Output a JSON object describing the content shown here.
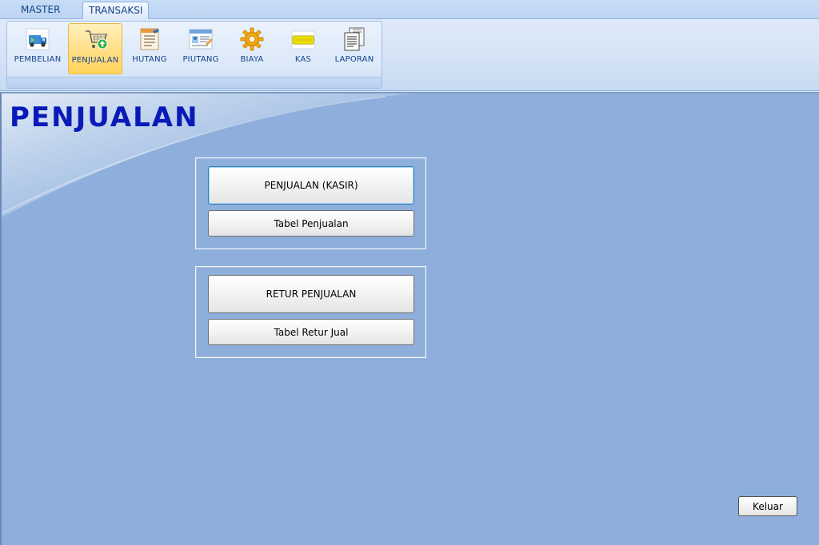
{
  "ribbon_tabs": [
    {
      "label": "MASTER",
      "active": false
    },
    {
      "label": "TRANSAKSI",
      "active": true
    }
  ],
  "ribbon_buttons": [
    {
      "label": "PEMBELIAN",
      "icon": "truck-icon"
    },
    {
      "label": "PENJUALAN",
      "icon": "shopping-cart-icon",
      "active": true
    },
    {
      "label": "HUTANG",
      "icon": "ledger-icon"
    },
    {
      "label": "PIUTANG",
      "icon": "id-card-icon"
    },
    {
      "label": "BIAYA",
      "icon": "gear-icon"
    },
    {
      "label": "KAS",
      "icon": "cash-icon"
    },
    {
      "label": "LAPORAN",
      "icon": "report-documents-icon"
    }
  ],
  "page": {
    "title": "PENJUALAN"
  },
  "panels": [
    {
      "primary_label": "PENJUALAN (KASIR)",
      "secondary_label": "Tabel Penjualan"
    },
    {
      "primary_label": "RETUR PENJUALAN",
      "secondary_label": "Tabel Retur Jual"
    }
  ],
  "footer": {
    "exit_label": "Keluar"
  },
  "colors": {
    "main_background": "#8eafdb",
    "title": "#0a1ab8",
    "ribbon_text": "#15428b",
    "active_ribbon_button": "#ffd35a"
  }
}
